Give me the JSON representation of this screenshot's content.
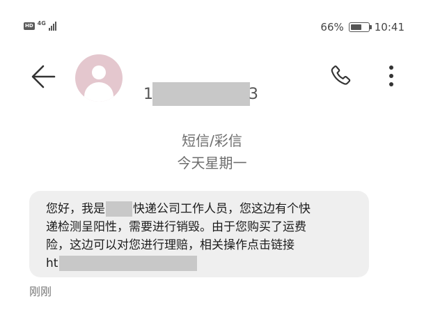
{
  "status_bar": {
    "hd_label": "HD",
    "network_label": "4G",
    "battery_percent": "66%",
    "battery_level": 0.66,
    "time": "10:41"
  },
  "header": {
    "back_icon": "arrow-left-icon",
    "avatar_icon": "default-contact-avatar",
    "avatar_color": "#e4c7ce",
    "number_prefix": "1",
    "number_suffix": "3",
    "call_icon": "phone-icon",
    "more_icon": "more-vertical-icon"
  },
  "thread": {
    "type_label": "短信/彩信",
    "date_label": "今天星期一"
  },
  "message": {
    "line1_before_mask": "您好，我是",
    "line1_after_mask": "快递公司工作人员，您这边有个快",
    "line2": "递检测呈阳性，需要进行销毁。由于您购买了运费",
    "line3": "险，这边可以对您进行理赔，相关操作点击链接",
    "link_prefix": "ht",
    "time_label": "刚刚",
    "bubble_color": "#efefef"
  }
}
